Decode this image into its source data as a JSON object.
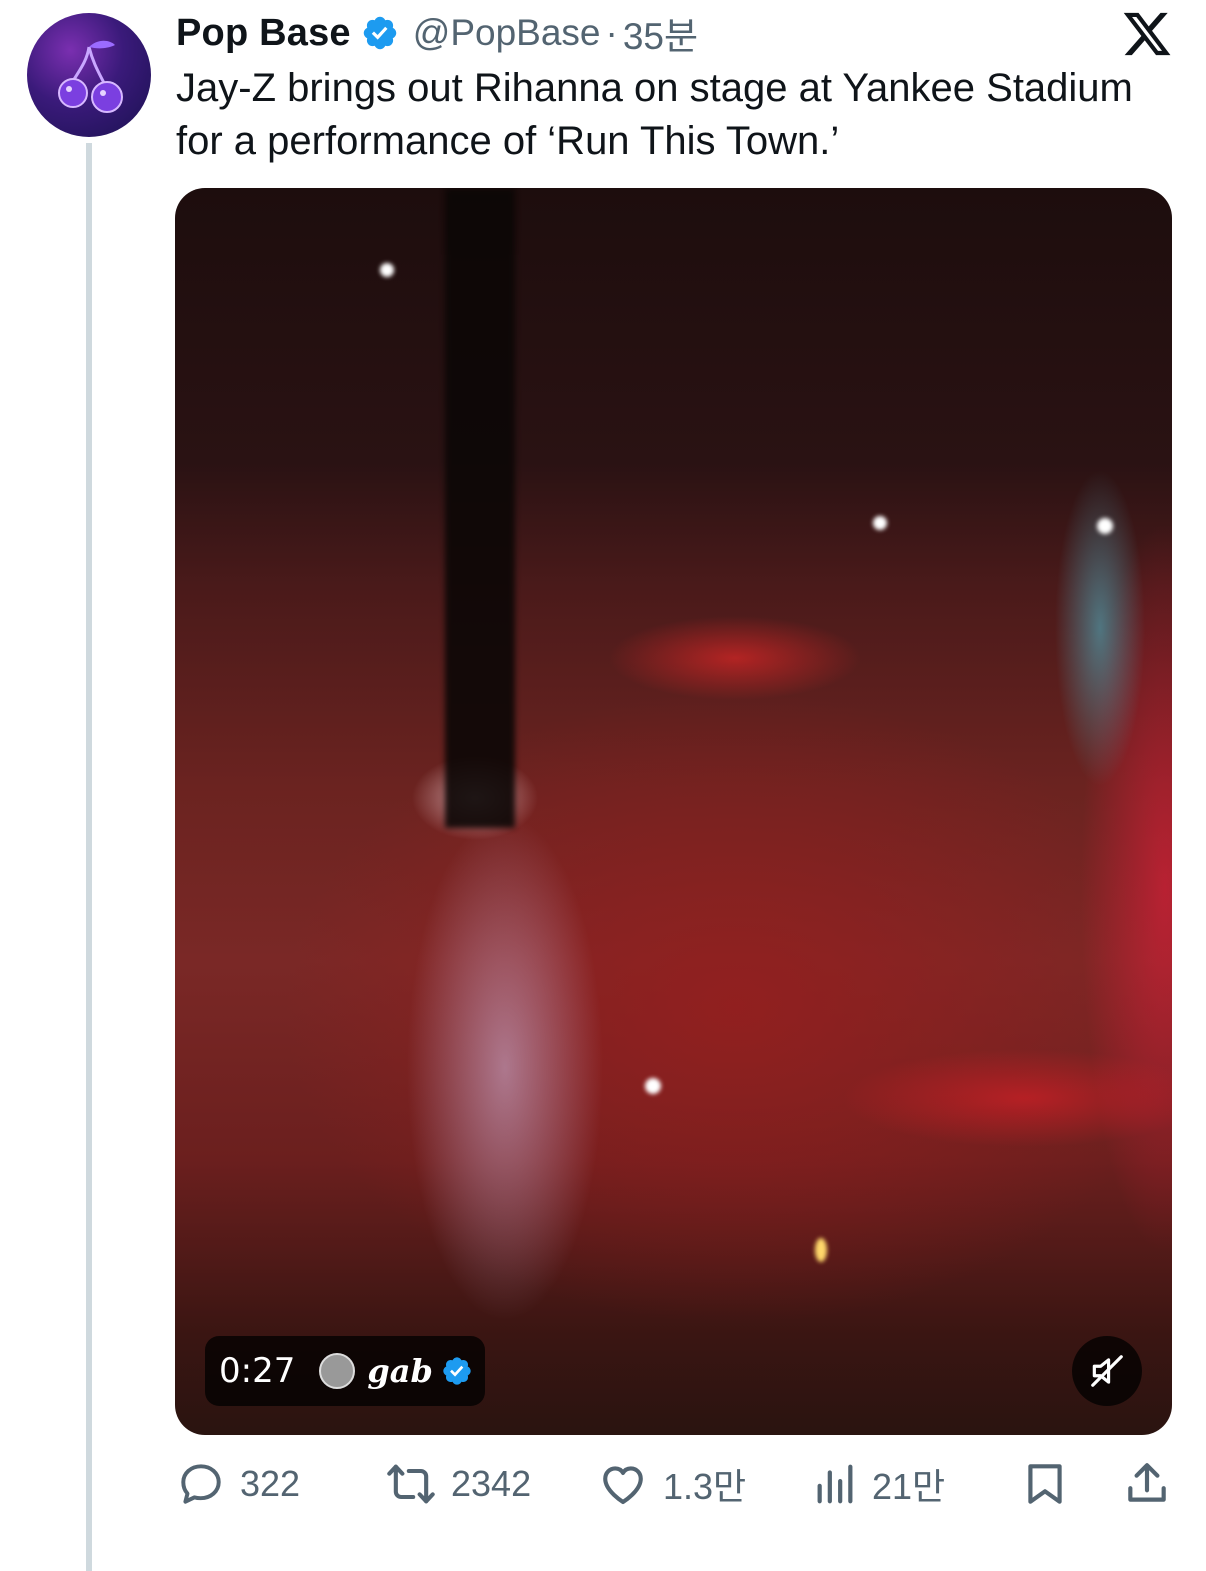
{
  "tweet": {
    "display_name": "Pop Base",
    "handle": "@PopBase",
    "separator": "·",
    "time": "35분",
    "text": "Jay-Z brings out Rihanna on stage at Yankee Stadium for a performance of ‘Run This Town.’"
  },
  "media": {
    "duration": "0:27",
    "source_name": "gab"
  },
  "actions": {
    "replies": "322",
    "retweets": "2342",
    "likes": "1.3만",
    "views": "21만"
  },
  "colors": {
    "verified": "#1d9bf0",
    "secondary_text": "#536471",
    "primary_text": "#0f1419",
    "thread_line": "#cfd9de"
  },
  "icons": {
    "logo": "x-logo-icon",
    "reply": "speech-bubble-icon",
    "retweet": "retweet-arrows-icon",
    "like": "heart-icon",
    "views": "bar-chart-icon",
    "bookmark": "bookmark-icon",
    "share": "share-upload-icon",
    "mute": "speaker-muted-icon"
  }
}
